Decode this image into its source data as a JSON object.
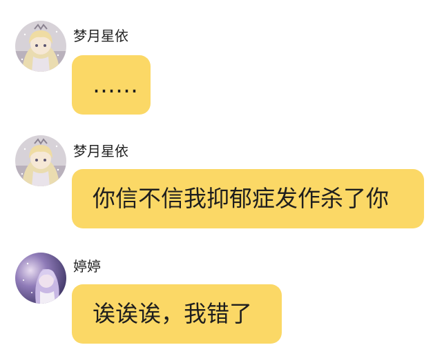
{
  "messages": [
    {
      "sender": "梦月星依",
      "text": "……",
      "avatar_icon": "anime-girl-blonde-avatar-icon"
    },
    {
      "sender": "梦月星依",
      "text": "你信不信我抑郁症发作杀了你",
      "avatar_icon": "anime-girl-blonde-avatar-icon"
    },
    {
      "sender": "婷婷",
      "text": "诶诶诶，我错了",
      "avatar_icon": "anime-girl-purple-avatar-icon"
    }
  ],
  "colors": {
    "bubble": "#fbd866",
    "text": "#1e1e1e",
    "background": "#ffffff"
  }
}
